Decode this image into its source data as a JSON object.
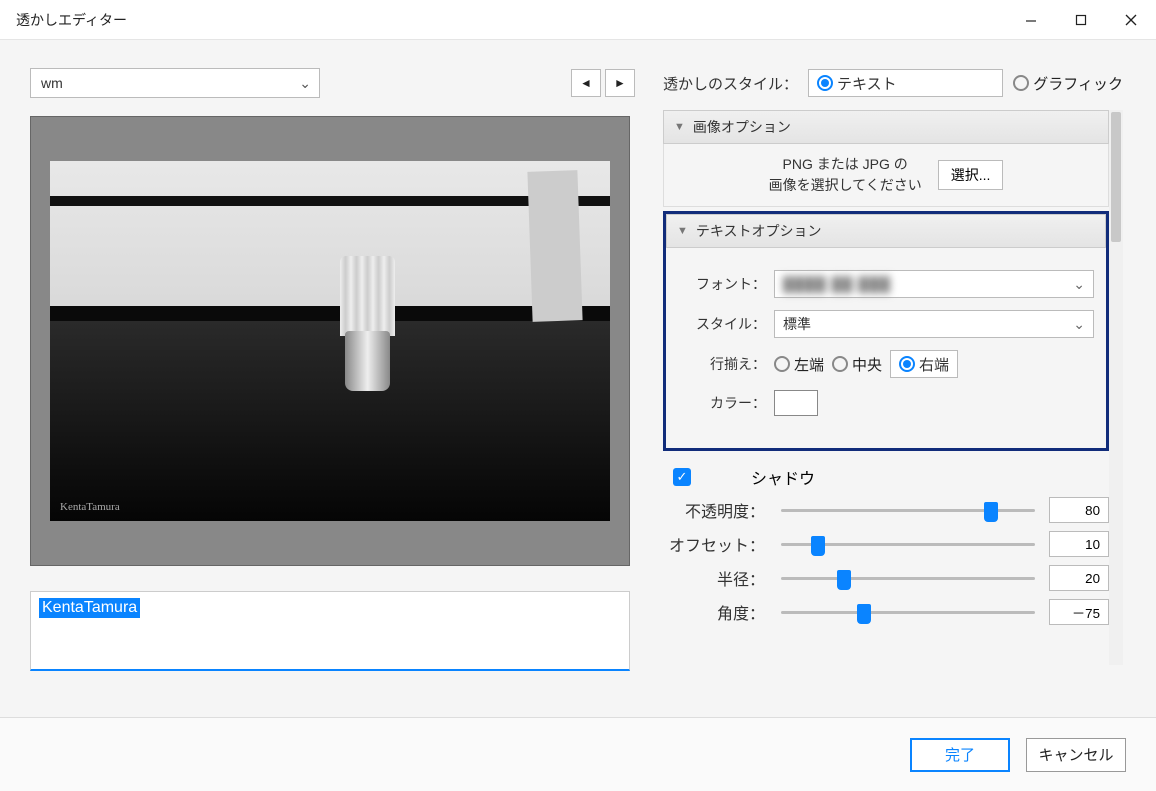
{
  "window": {
    "title": "透かしエディター"
  },
  "preset": {
    "selected": "wm"
  },
  "textInput": {
    "value": "KentaTamura"
  },
  "preview": {
    "signature": "KentaTamura"
  },
  "styleRow": {
    "label": "透かしのスタイル：",
    "optText": "テキスト",
    "optGraphic": "グラフィック",
    "selected": "text"
  },
  "sections": {
    "image": {
      "title": "画像オプション",
      "hint1": "PNG または JPG の",
      "hint2": "画像を選択してください",
      "choose": "選択..."
    },
    "text": {
      "title": "テキストオプション",
      "fontLabel": "フォント：",
      "fontValue": "████ ██ ███",
      "styleLabel": "スタイル：",
      "styleValue": "標準",
      "alignLabel": "行揃え：",
      "alignLeft": "左端",
      "alignCenter": "中央",
      "alignRight": "右端",
      "alignSelected": "right",
      "colorLabel": "カラー：",
      "colorValue": "#ffffff"
    },
    "shadow": {
      "label": "シャドウ",
      "checked": true,
      "opacityLabel": "不透明度：",
      "opacityValue": "80",
      "opacityPct": 80,
      "offsetLabel": "オフセット：",
      "offsetValue": "10",
      "offsetPct": 12,
      "radiusLabel": "半径：",
      "radiusValue": "20",
      "radiusPct": 22,
      "angleLabel": "角度：",
      "angleValue": "－75",
      "anglePct": 30
    }
  },
  "footer": {
    "done": "完了",
    "cancel": "キャンセル"
  }
}
